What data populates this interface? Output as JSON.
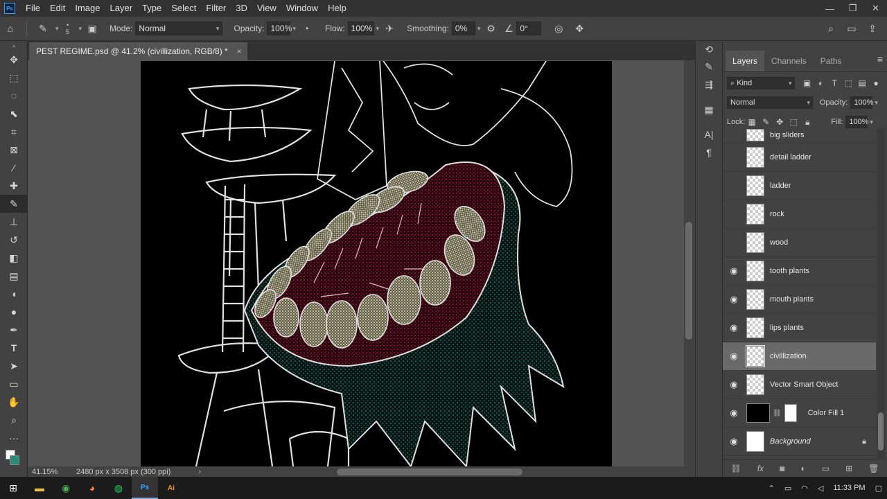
{
  "menubar": {
    "logo": "Ps",
    "items": [
      "File",
      "Edit",
      "Image",
      "Layer",
      "Type",
      "Select",
      "Filter",
      "3D",
      "View",
      "Window",
      "Help"
    ],
    "controls": [
      "—",
      "❐",
      "✕"
    ]
  },
  "options": {
    "brush_size": "5",
    "mode_label": "Mode:",
    "mode_value": "Normal",
    "opacity_label": "Opacity:",
    "opacity_value": "100%",
    "flow_label": "Flow:",
    "flow_value": "100%",
    "smoothing_label": "Smoothing:",
    "smoothing_value": "0%",
    "angle_value": "0°"
  },
  "document": {
    "tab_title": "PEST REGIME.psd @ 41.2% (civillization, RGB/8) *",
    "zoom": "41.15%",
    "info": "2480 px x 3508 px (300 ppi)"
  },
  "layers_panel": {
    "tabs": [
      "Layers",
      "Channels",
      "Paths"
    ],
    "active_tab": "Layers",
    "filter_kind": "Kind",
    "blend_mode": "Normal",
    "opacity_label": "Opacity:",
    "opacity_value": "100%",
    "lock_label": "Lock:",
    "fill_label": "Fill:",
    "fill_value": "100%",
    "layers": [
      {
        "name": "big sliders",
        "visible": false
      },
      {
        "name": "detail ladder",
        "visible": false
      },
      {
        "name": "ladder",
        "visible": false
      },
      {
        "name": "rock",
        "visible": false
      },
      {
        "name": "wood",
        "visible": false
      },
      {
        "name": "tooth plants",
        "visible": true
      },
      {
        "name": "mouth plants",
        "visible": true
      },
      {
        "name": "lips plants",
        "visible": true
      },
      {
        "name": "civillization",
        "visible": true,
        "selected": true
      },
      {
        "name": "Vector Smart Object",
        "visible": true
      },
      {
        "name": "Color Fill 1",
        "visible": true
      },
      {
        "name": "Background",
        "visible": true,
        "locked": true
      }
    ]
  },
  "taskbar": {
    "time": "11:33 PM"
  },
  "colors": {
    "mouth_red": "#7a1428",
    "teeth": "#d8d3b0",
    "plant_teal": "#2c8a78",
    "outline": "#e0e0e0"
  }
}
